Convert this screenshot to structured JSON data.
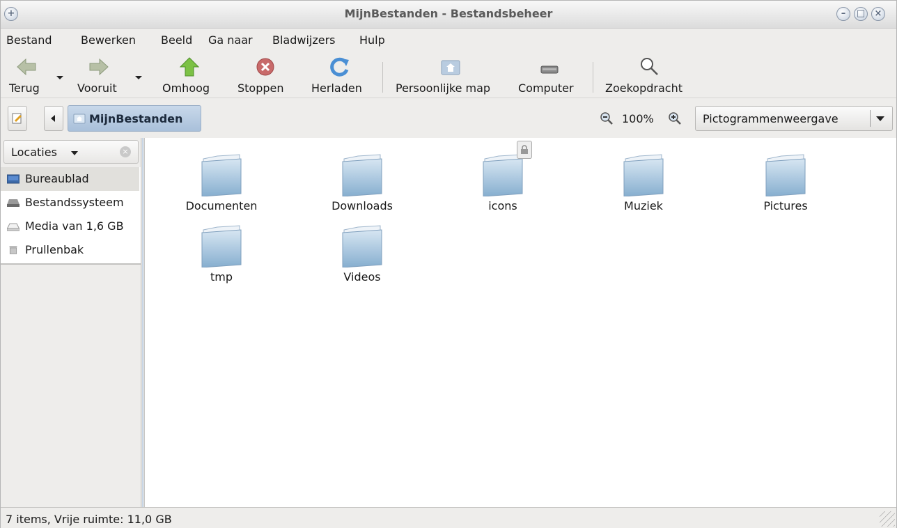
{
  "window": {
    "title": "MijnBestanden - Bestandsbeheer"
  },
  "menu": {
    "items": [
      {
        "label": "Bestand"
      },
      {
        "label": "Bewerken"
      },
      {
        "label": "Beeld"
      },
      {
        "label": "Ga naar"
      },
      {
        "label": "Bladwijzers"
      },
      {
        "label": "Hulp"
      }
    ]
  },
  "toolbar": {
    "back": "Terug",
    "forward": "Vooruit",
    "up": "Omhoog",
    "stop": "Stoppen",
    "reload": "Herladen",
    "home": "Persoonlijke map",
    "computer": "Computer",
    "search": "Zoekopdracht"
  },
  "location": {
    "path_label": "MijnBestanden",
    "zoom": "100%",
    "view_mode": "Pictogrammenweergave"
  },
  "sidebar": {
    "header": "Locaties",
    "places": [
      {
        "label": "Bureaublad"
      },
      {
        "label": "Bestandssysteem"
      },
      {
        "label": "Media van 1,6 GB"
      },
      {
        "label": "Prullenbak"
      }
    ]
  },
  "files": [
    {
      "name": "Documenten"
    },
    {
      "name": "Downloads"
    },
    {
      "name": "icons",
      "locked": true
    },
    {
      "name": "Muziek"
    },
    {
      "name": "Pictures"
    },
    {
      "name": "tmp"
    },
    {
      "name": "Videos"
    }
  ],
  "status": {
    "text": "7 items, Vrije ruimte: 11,0 GB"
  }
}
